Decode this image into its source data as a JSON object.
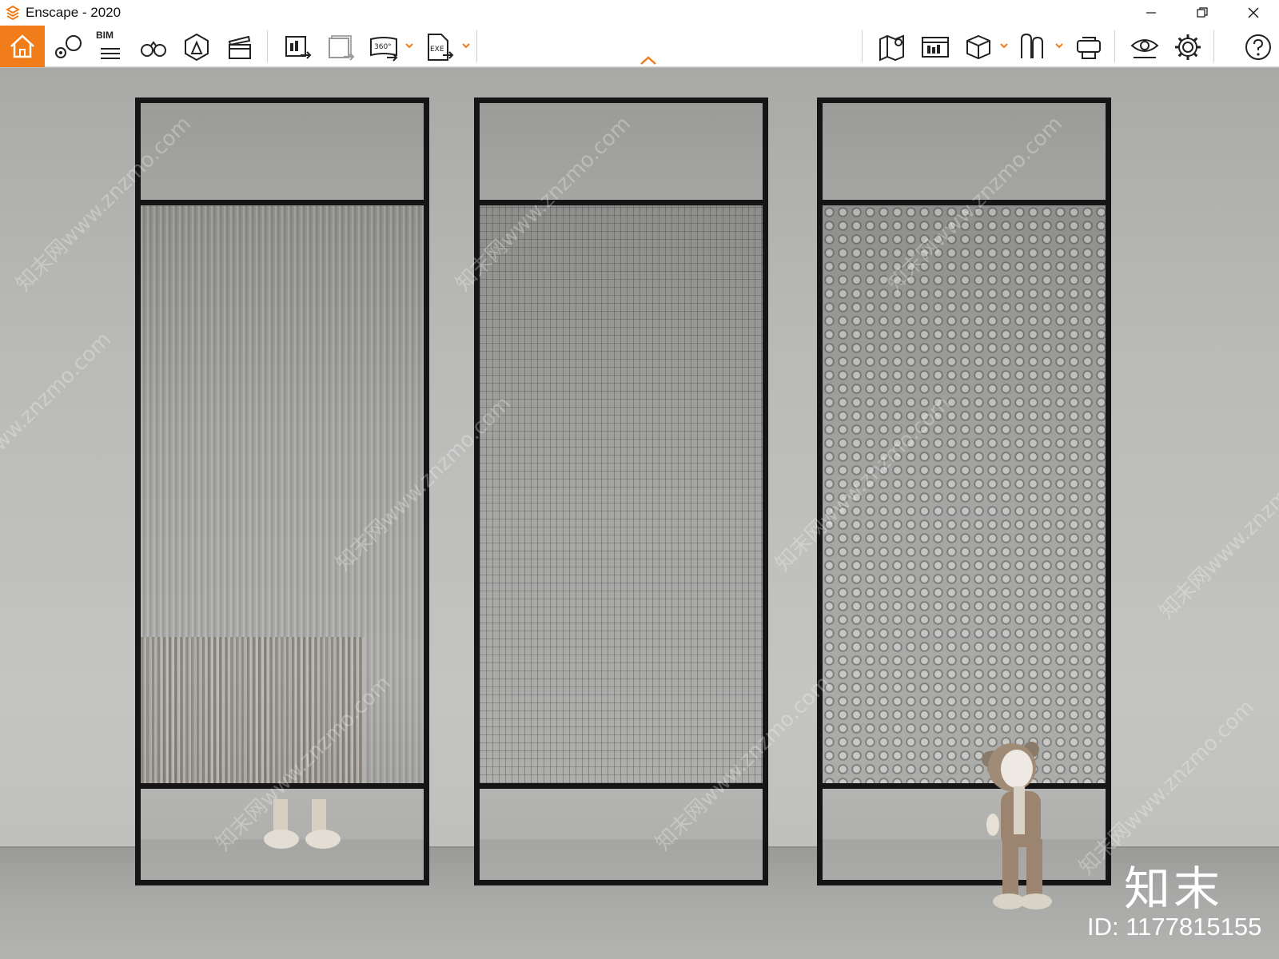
{
  "window": {
    "title": "Enscape - 2020",
    "controls": [
      "minimize",
      "restore",
      "close"
    ]
  },
  "toolbar": {
    "bim_label": "BIM",
    "buttons": [
      {
        "name": "home",
        "icon": "home-icon",
        "active": true
      },
      {
        "name": "views",
        "icon": "location-pin-icon"
      },
      {
        "name": "bim",
        "icon": "bim-list-icon"
      },
      {
        "name": "binoculars",
        "icon": "binoculars-icon"
      },
      {
        "name": "asset-library",
        "icon": "asset-library-icon"
      },
      {
        "name": "video-editor",
        "icon": "clapperboard-icon"
      },
      {
        "name": "render-image",
        "icon": "render-image-icon"
      },
      {
        "name": "batch-render",
        "icon": "batch-render-icon"
      },
      {
        "name": "render-360",
        "icon": "panorama-360-icon",
        "label": "360°"
      },
      {
        "name": "export-exe",
        "icon": "export-exe-icon",
        "label": "EXE"
      },
      {
        "name": "map",
        "icon": "map-icon"
      },
      {
        "name": "web-standalone",
        "icon": "web-standalone-icon"
      },
      {
        "name": "orthographic",
        "icon": "cube-icon"
      },
      {
        "name": "collaborative",
        "icon": "annotation-icon"
      },
      {
        "name": "vr-headset",
        "icon": "vr-headset-icon"
      },
      {
        "name": "visual-settings",
        "icon": "eye-icon"
      },
      {
        "name": "settings",
        "icon": "gear-icon"
      },
      {
        "name": "help",
        "icon": "help-icon"
      }
    ],
    "accent_color": "#f07d19"
  },
  "viewport": {
    "watermark_text": "知末网www.znzmo.com",
    "brand_logo": "知末",
    "brand_id": "ID: 1177815155"
  }
}
